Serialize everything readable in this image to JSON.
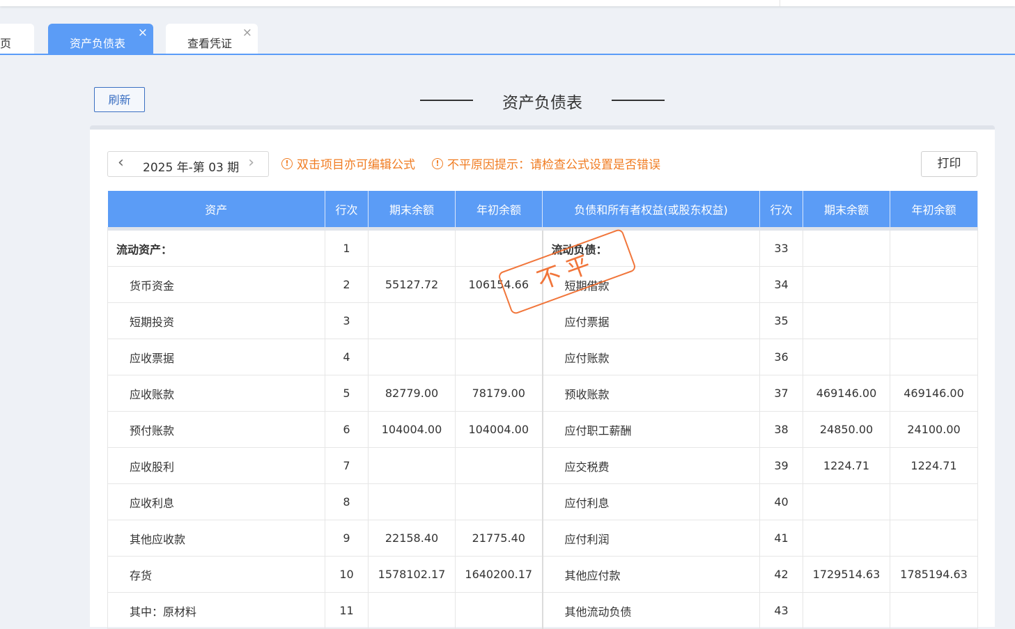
{
  "tabs": [
    {
      "label": "页"
    },
    {
      "label": "资产负债表",
      "close": "×"
    },
    {
      "label": "查看凭证",
      "close": "×"
    }
  ],
  "toolbar": {
    "refresh_label": "刷新",
    "print_label": "打印"
  },
  "page_title": "资产负债表",
  "period": {
    "label": "2025 年-第 03 期"
  },
  "hints": [
    "双击项目亦可编辑公式",
    "不平原因提示：请检查公式设置是否错误"
  ],
  "stamp_text": "不平",
  "table": {
    "headers": [
      "资产",
      "行次",
      "期末余额",
      "年初余额",
      "负债和所有者权益(或股东权益)",
      "行次",
      "期末余额",
      "年初余额"
    ],
    "rows": [
      {
        "a_name": "流动资产：",
        "a_bold": true,
        "a_no": "1",
        "a_end": "",
        "a_start": "",
        "l_name": "流动负债：",
        "l_bold": true,
        "l_no": "33",
        "l_end": "",
        "l_start": ""
      },
      {
        "a_name": "货币资金",
        "a_no": "2",
        "a_end": "55127.72",
        "a_start": "106154.66",
        "l_name": "短期借款",
        "l_no": "34",
        "l_end": "",
        "l_start": ""
      },
      {
        "a_name": "短期投资",
        "a_no": "3",
        "a_end": "",
        "a_start": "",
        "l_name": "应付票据",
        "l_no": "35",
        "l_end": "",
        "l_start": ""
      },
      {
        "a_name": "应收票据",
        "a_no": "4",
        "a_end": "",
        "a_start": "",
        "l_name": "应付账款",
        "l_no": "36",
        "l_end": "",
        "l_start": ""
      },
      {
        "a_name": "应收账款",
        "a_no": "5",
        "a_end": "82779.00",
        "a_start": "78179.00",
        "l_name": "预收账款",
        "l_no": "37",
        "l_end": "469146.00",
        "l_start": "469146.00"
      },
      {
        "a_name": "预付账款",
        "a_no": "6",
        "a_end": "104004.00",
        "a_start": "104004.00",
        "l_name": "应付职工薪酬",
        "l_no": "38",
        "l_end": "24850.00",
        "l_start": "24100.00"
      },
      {
        "a_name": "应收股利",
        "a_no": "7",
        "a_end": "",
        "a_start": "",
        "l_name": "应交税费",
        "l_no": "39",
        "l_end": "1224.71",
        "l_start": "1224.71"
      },
      {
        "a_name": "应收利息",
        "a_no": "8",
        "a_end": "",
        "a_start": "",
        "l_name": "应付利息",
        "l_no": "40",
        "l_end": "",
        "l_start": ""
      },
      {
        "a_name": "其他应收款",
        "a_no": "9",
        "a_end": "22158.40",
        "a_start": "21775.40",
        "l_name": "应付利润",
        "l_no": "41",
        "l_end": "",
        "l_start": ""
      },
      {
        "a_name": "存货",
        "a_no": "10",
        "a_end": "1578102.17",
        "a_start": "1640200.17",
        "l_name": "其他应付款",
        "l_no": "42",
        "l_end": "1729514.63",
        "l_start": "1785194.63"
      },
      {
        "a_name": "其中：原材料",
        "a_no": "11",
        "a_end": "",
        "a_start": "",
        "l_name": "其他流动负债",
        "l_no": "43",
        "l_end": "",
        "l_start": ""
      }
    ]
  }
}
